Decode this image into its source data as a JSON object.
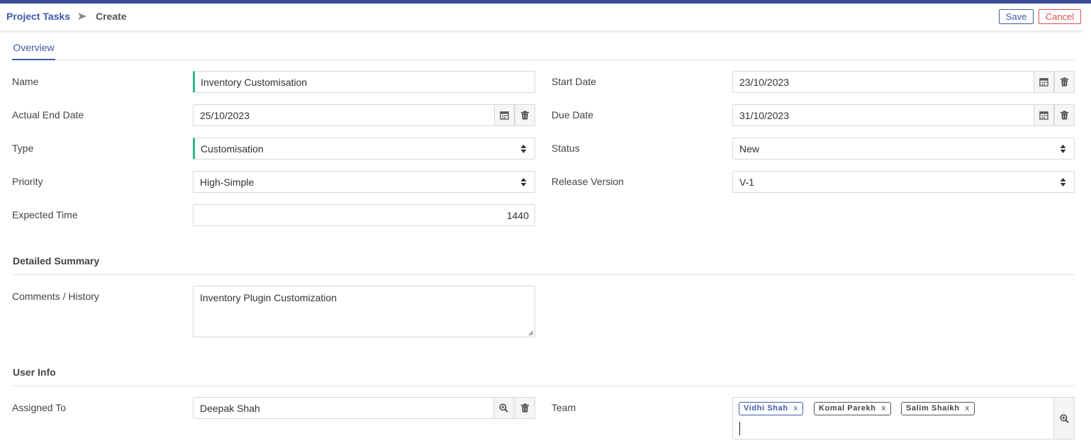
{
  "breadcrumb": {
    "parent": "Project Tasks",
    "current": "Create"
  },
  "toolbar": {
    "save_label": "Save",
    "cancel_label": "Cancel"
  },
  "tabs": [
    {
      "label": "Overview",
      "active": true
    }
  ],
  "form": {
    "name": {
      "label": "Name",
      "value": "Inventory Customisation"
    },
    "start_date": {
      "label": "Start Date",
      "value": "23/10/2023"
    },
    "actual_end_date": {
      "label": "Actual End Date",
      "value": "25/10/2023"
    },
    "due_date": {
      "label": "Due Date",
      "value": "31/10/2023"
    },
    "type": {
      "label": "Type",
      "value": "Customisation"
    },
    "status": {
      "label": "Status",
      "value": "New"
    },
    "priority": {
      "label": "Priority",
      "value": "High-Simple"
    },
    "release_version": {
      "label": "Release Version",
      "value": "V-1"
    },
    "expected_time": {
      "label": "Expected Time",
      "value": "1440"
    }
  },
  "detailed_summary": {
    "title": "Detailed Summary",
    "comments": {
      "label": "Comments / History",
      "value": "Inventory Plugin Customization"
    }
  },
  "user_info": {
    "title": "User Info",
    "assigned_to": {
      "label": "Assigned To",
      "value": "Deepak Shah"
    },
    "team": {
      "label": "Team",
      "members": [
        "Vidhi Shah",
        "Komal Parekh",
        "Salim Shaikh"
      ],
      "remove_symbol": "x"
    }
  },
  "colors": {
    "accent": "#3d5aa8",
    "danger": "#d9534f",
    "required": "#2bb58d",
    "topbar": "#3d4d99"
  },
  "icons": {
    "breadcrumb_separator": "chevron-right-icon",
    "date_picker": "calendar-icon",
    "clear": "trash-icon",
    "lookup": "search-plus-icon",
    "select": "sort-icon"
  }
}
